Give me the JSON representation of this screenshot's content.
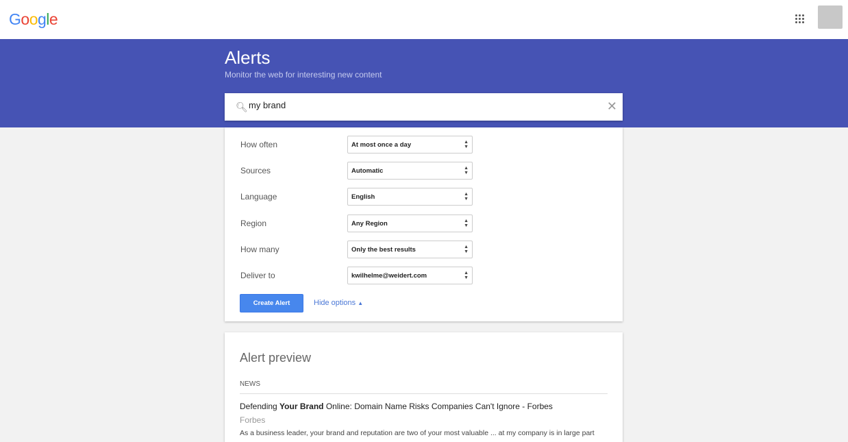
{
  "header": {
    "logo_letters": [
      "G",
      "o",
      "o",
      "g",
      "l",
      "e"
    ],
    "apps_icon": "grid-icon",
    "avatar": "user-avatar"
  },
  "hero": {
    "title": "Alerts",
    "subtitle": "Monitor the web for interesting new content"
  },
  "search": {
    "value": "my brand",
    "icon": "search-icon",
    "clear_icon": "close-icon"
  },
  "options": [
    {
      "label": "How often",
      "value": "At most once a day"
    },
    {
      "label": "Sources",
      "value": "Automatic"
    },
    {
      "label": "Language",
      "value": "English"
    },
    {
      "label": "Region",
      "value": "Any Region"
    },
    {
      "label": "How many",
      "value": "Only the best results"
    },
    {
      "label": "Deliver to",
      "value": "kwilhelme@weidert.com"
    }
  ],
  "actions": {
    "create": "Create Alert",
    "hide": "Hide options",
    "hide_icon": "caret-up-icon"
  },
  "colors": {
    "header_band": "#4653b4",
    "button": "#4787ed",
    "link": "#4a77d6"
  },
  "preview": {
    "title": "Alert preview",
    "section": "NEWS",
    "article": {
      "pre": "Defending ",
      "bold": "Your Brand",
      "post": " Online: Domain Name Risks Companies Can't Ignore - Forbes",
      "source": "Forbes",
      "snippet": "As a business leader, your brand and reputation are two of your most valuable ... at my company is in large part"
    }
  }
}
